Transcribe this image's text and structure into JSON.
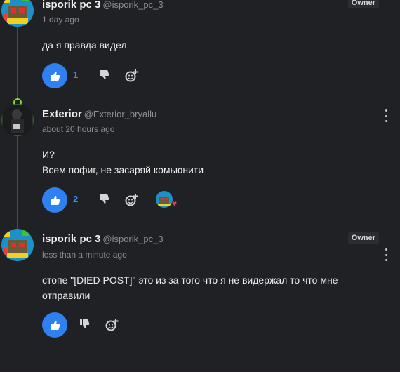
{
  "comments": [
    {
      "name": "isporik pc 3",
      "handle": "@isporik_pc_3",
      "badge": "Owner",
      "time": "1 day ago",
      "text": "да я правда видел",
      "likes": "1",
      "avatar": "pixel-robot-avatar"
    },
    {
      "name": "Exterior",
      "handle": "@Exterior_bryallu",
      "time": "about 20 hours ago",
      "text_line1": "И?",
      "text_line2": "Всем пофиг, не засаряй комьюнити",
      "likes": "2",
      "avatar": "dark-photo-avatar",
      "reaction": "heart"
    },
    {
      "name": "isporik pc 3",
      "handle": "@isporik_pc_3",
      "badge": "Owner",
      "time": "less than a minute ago",
      "text_line1": "стопе \"[DIED POST]\" это из за того что я не видержал то что мне",
      "text_line2": "отправили",
      "avatar": "pixel-robot-avatar"
    }
  ],
  "colors": {
    "background": "#202124",
    "like_blue": "#2f80f0",
    "count_blue": "#3f8ef5",
    "heart": "#ee3a58",
    "lock_green": "#8bd14a"
  }
}
